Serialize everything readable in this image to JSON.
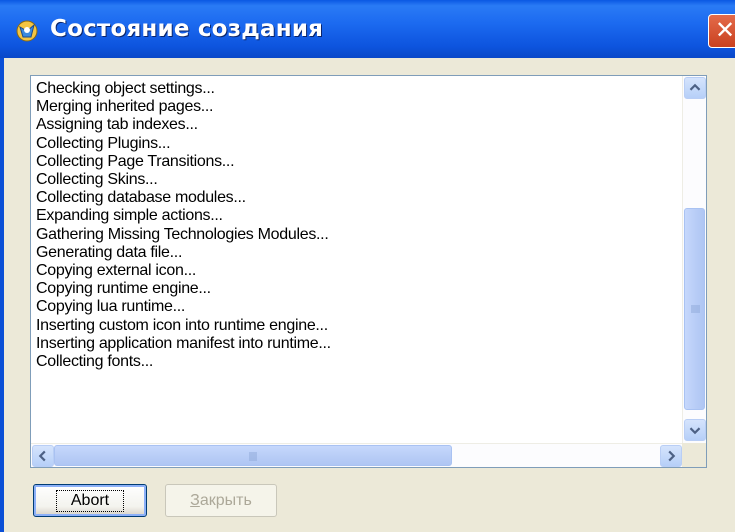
{
  "window": {
    "title": "Состояние создания",
    "close_symbol": "✕",
    "icon": "app-icon"
  },
  "log": {
    "lines": [
      "Checking object settings...",
      "Merging inherited pages...",
      "Assigning tab indexes...",
      "Collecting Plugins...",
      "Collecting Page Transitions...",
      "Collecting Skins...",
      "Collecting database modules...",
      "Expanding simple actions...",
      "Gathering Missing Technologies Modules...",
      "Generating data file...",
      "Copying external icon...",
      "Copying runtime engine...",
      "Copying lua runtime...",
      "Inserting custom icon into runtime engine...",
      "Inserting application manifest into runtime...",
      "Collecting fonts..."
    ]
  },
  "buttons": {
    "abort_label": "Abort",
    "close_label": "Закрыть"
  },
  "colors": {
    "titlebar": "#0A58E3",
    "dialog_bg": "#ECE9D8",
    "scroll_thumb": "#B7CCF6"
  }
}
